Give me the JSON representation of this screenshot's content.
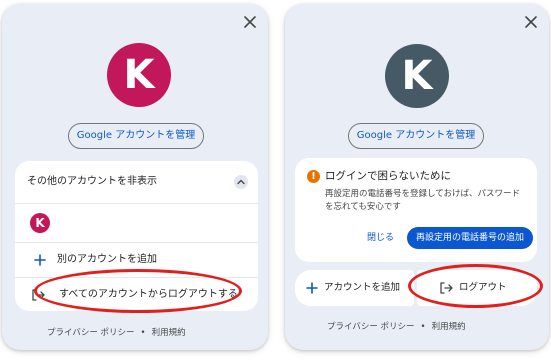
{
  "left_card": {
    "avatar_letter": "K",
    "avatar_color": "#c2185b",
    "manage_account_label": "Google アカウントを管理",
    "other_accounts_toggle_label": "その他のアカウントを非表示",
    "account_avatar_letter": "K",
    "add_account_label": "別のアカウントを追加",
    "logout_all_label": "すべてのアカウントからログアウトする",
    "footer": {
      "privacy_label": "プライバシー ポリシー",
      "separator": "•",
      "terms_label": "利用規約"
    }
  },
  "right_card": {
    "avatar_letter": "K",
    "avatar_color": "#455a64",
    "manage_account_label": "Google アカウントを管理",
    "alert": {
      "icon_glyph": "!",
      "icon_name": "warning-icon",
      "title": "ログインで困らないために",
      "body": "再設定用の電話番号を登録しておけば、パスワードを忘れても安心です",
      "close_label": "閉じる",
      "primary_label": "再設定用の電話番号の追加"
    },
    "add_account_label": "アカウントを追加",
    "logout_label": "ログアウト",
    "footer": {
      "privacy_label": "プライバシー ポリシー",
      "separator": "•",
      "terms_label": "利用規約"
    }
  },
  "colors": {
    "accent_blue": "#0b57d0",
    "highlight_red": "#e0201c",
    "card_bg": "#e9eef6"
  }
}
